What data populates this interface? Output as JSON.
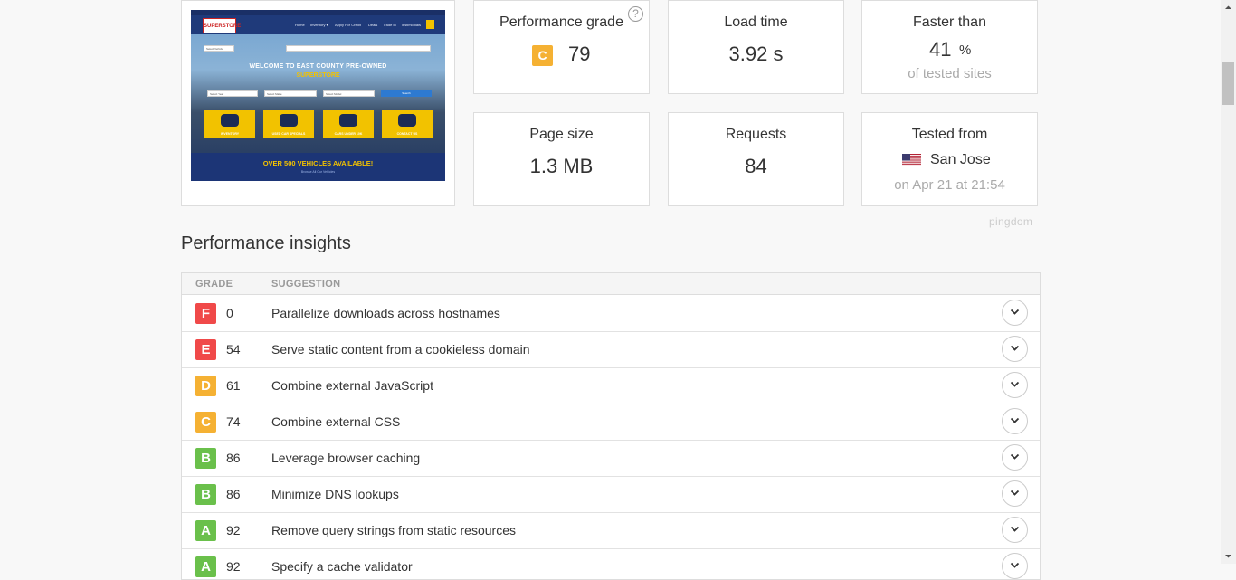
{
  "screenshot": {
    "logo": "SUPERSTORE",
    "nav": [
      "Home",
      "Inventory ▾",
      "Apply For Credit",
      "Deals",
      "Trade In",
      "Testimonials"
    ],
    "selects": [
      "Select Year",
      "Select Make",
      "Select Model"
    ],
    "search_label": "Search",
    "search_top": "Select Vehicle",
    "headline": "WELCOME TO EAST COUNTY PRE-OWNED",
    "subheadline": "SUPERSTORE",
    "tiles": [
      "INVENTORY",
      "USED CAR SPECIALS",
      "CARS UNDER 10K",
      "CONTACT US"
    ],
    "banner": "OVER 500 VEHICLES AVAILABLE!",
    "banner_link": "Browse All Our Vehicles"
  },
  "metrics": {
    "performance_grade": {
      "label": "Performance grade",
      "letter": "C",
      "score": "79",
      "help": "?"
    },
    "load_time": {
      "label": "Load time",
      "value": "3.92 s"
    },
    "faster_than": {
      "label": "Faster than",
      "value": "41",
      "unit": "%",
      "sub": "of tested sites"
    },
    "page_size": {
      "label": "Page size",
      "value": "1.3 MB"
    },
    "requests": {
      "label": "Requests",
      "value": "84"
    },
    "tested_from": {
      "label": "Tested from",
      "location": "San Jose",
      "date": "on Apr 21 at 21:54"
    }
  },
  "branding": "pingdom",
  "insights": {
    "title": "Performance insights",
    "columns": {
      "grade": "GRADE",
      "suggestion": "SUGGESTION"
    },
    "rows": [
      {
        "letter": "F",
        "score": "0",
        "text": "Parallelize downloads across hostnames"
      },
      {
        "letter": "E",
        "score": "54",
        "text": "Serve static content from a cookieless domain"
      },
      {
        "letter": "D",
        "score": "61",
        "text": "Combine external JavaScript"
      },
      {
        "letter": "C",
        "score": "74",
        "text": "Combine external CSS"
      },
      {
        "letter": "B",
        "score": "86",
        "text": "Leverage browser caching"
      },
      {
        "letter": "B",
        "score": "86",
        "text": "Minimize DNS lookups"
      },
      {
        "letter": "A",
        "score": "92",
        "text": "Remove query strings from static resources"
      },
      {
        "letter": "A",
        "score": "92",
        "text": "Specify a cache validator"
      }
    ]
  },
  "colors": {
    "grade_F": "#f04949",
    "grade_E": "#f04949",
    "grade_D": "#f5b133",
    "grade_C": "#f5b133",
    "grade_B": "#6ac04b",
    "grade_A": "#6ac04b"
  }
}
